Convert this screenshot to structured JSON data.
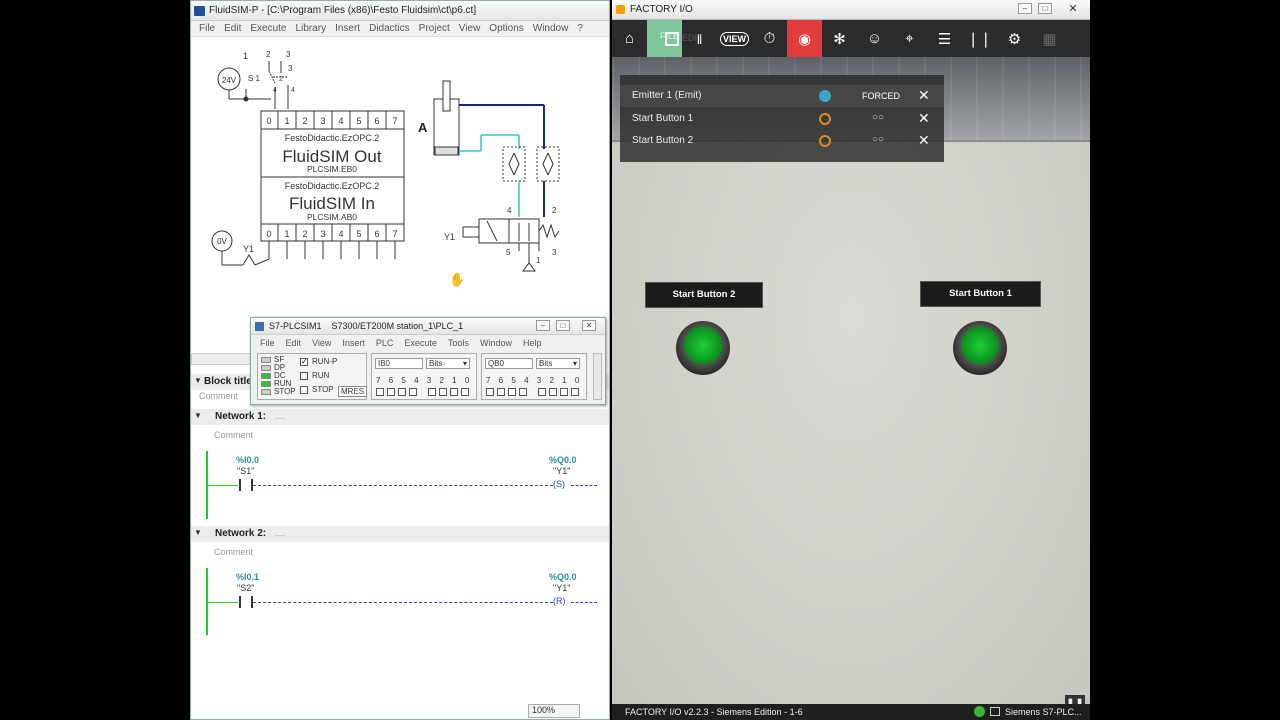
{
  "fluidsim": {
    "title": "FluidSIM-P - [C:\\Program Files (x86)\\Festo Fluidsim\\ct\\p6.ct]",
    "menu": [
      "File",
      "Edit",
      "Execute",
      "Library",
      "Insert",
      "Didactics",
      "Project",
      "View",
      "Options",
      "Window",
      "?"
    ],
    "power_24v": "24V",
    "power_0v": "0V",
    "switch_label": "S 1",
    "switch_pins": [
      "1",
      "2",
      "3",
      "3",
      "2",
      "4",
      "4"
    ],
    "coil_label": "Y1",
    "io_bits": [
      "0",
      "1",
      "2",
      "3",
      "4",
      "5",
      "6",
      "7"
    ],
    "out_block": {
      "vendor": "FestoDidactic.EzOPC.2",
      "name": "FluidSIM Out",
      "address": "PLCSIM.EB0"
    },
    "in_block": {
      "vendor": "FestoDidactic.EzOPC.2",
      "name": "FluidSIM In",
      "address": "PLCSIM.AB0"
    },
    "cylinder_label": "A",
    "valve_label": "Y1",
    "valve_ports": [
      "4",
      "2",
      "5",
      "3",
      "1"
    ],
    "zoom": "100%"
  },
  "tia": {
    "block_title": "Block title",
    "block_comment": "Comment",
    "networks": [
      {
        "title": "Network 1:",
        "dots": "....",
        "comment": "Comment",
        "contact_addr": "%I0.0",
        "contact_name": "\"S1\"",
        "coil_addr": "%Q0.0",
        "coil_name": "\"Y1\"",
        "coil_type": "S"
      },
      {
        "title": "Network 2:",
        "dots": "....",
        "comment": "Comment",
        "contact_addr": "%I0.1",
        "contact_name": "\"S2\"",
        "coil_addr": "%Q0.0",
        "coil_name": "\"Y1\"",
        "coil_type": "R"
      }
    ]
  },
  "plcsim": {
    "title": "S7-PLCSIM1    S7300/ET200M station_1\\PLC_1",
    "menu": [
      "File",
      "Edit",
      "View",
      "Insert",
      "PLC",
      "Execute",
      "Tools",
      "Window",
      "Help"
    ],
    "leds": [
      "SF",
      "DP",
      "DC",
      "RUN",
      "STOP"
    ],
    "modes": [
      {
        "label": "RUN-P",
        "checked": true
      },
      {
        "label": "RUN",
        "checked": false
      },
      {
        "label": "STOP",
        "checked": false
      }
    ],
    "mres": "MRES",
    "input_var": {
      "address": "IB0",
      "format": "Bits"
    },
    "output_var": {
      "address": "QB0",
      "format": "Bits"
    },
    "bit_labels": [
      "7",
      "6",
      "5",
      "4",
      "3",
      "2",
      "1",
      "0"
    ]
  },
  "factoryio": {
    "title": "FACTORY I/O",
    "toolbar_file": "FILE",
    "toolbar_edit": "EDIT",
    "toolbar_view": "VIEW",
    "tags": [
      {
        "name": "Emitter 1 (Emit)",
        "state": "FORCED"
      },
      {
        "name": "Start Button 1",
        "state": ""
      },
      {
        "name": "Start Button 2",
        "state": ""
      }
    ],
    "sign_left": "Start Button 2",
    "sign_right": "Start Button 1",
    "status_left": "FACTORY I/O v2.2.3 - Siemens Edition - 1-6",
    "status_right": "Siemens S7-PLC...",
    "accent": "#e23b3b"
  }
}
